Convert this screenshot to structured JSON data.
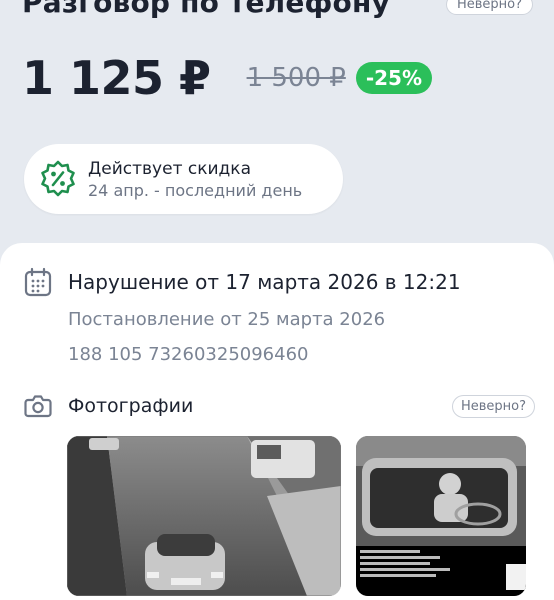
{
  "header": {
    "title": "Разговор по телефону",
    "wrong_label": "Неверно?"
  },
  "price": {
    "current": "1 125 ₽",
    "old": "1 500 ₽",
    "discount": "-25%"
  },
  "promo": {
    "line1": "Действует скидка",
    "line2": "24 апр. - последний день"
  },
  "violation": {
    "title": "Нарушение от 17 марта 2026 в 12:21",
    "resolution": "Постановление от 25 марта 2026",
    "number": "188 105 73260325096460"
  },
  "photos": {
    "label": "Фотографии",
    "wrong_label": "Неверно?"
  },
  "colors": {
    "background": "#e6eaf0",
    "discount_green": "#2bbf5a",
    "text_dark": "#1c2230",
    "text_muted": "#7b8494"
  }
}
